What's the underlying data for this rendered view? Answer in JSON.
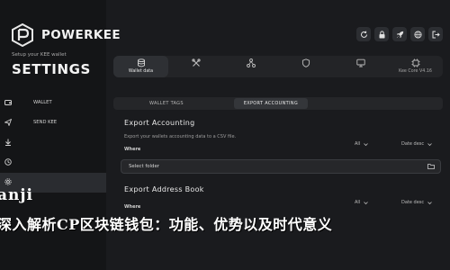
{
  "app": {
    "name": "POWERKEE",
    "setup_label": "Setup your KEE wallet",
    "section_title": "SETTINGS"
  },
  "sidebar": {
    "items": [
      {
        "label": "WALLET",
        "icon": "wallet-icon"
      },
      {
        "label": "SEND KEE",
        "icon": "send-icon"
      },
      {
        "label": "",
        "icon": "receive-icon"
      },
      {
        "label": "",
        "icon": "history-icon"
      },
      {
        "label": "",
        "icon": "settings-icon"
      }
    ]
  },
  "top_icons": [
    "sync-icon",
    "lock-icon",
    "rocket-icon",
    "globe-icon",
    "exit-icon"
  ],
  "tabs": [
    {
      "label": "Wallet data",
      "icon": "database-icon",
      "active": true
    },
    {
      "label": "",
      "icon": "tools-icon",
      "active": false
    },
    {
      "label": "",
      "icon": "network-icon",
      "active": false
    },
    {
      "label": "",
      "icon": "shield-icon",
      "active": false
    },
    {
      "label": "",
      "icon": "display-icon",
      "active": false
    },
    {
      "label": "Kee Core V4.16",
      "icon": "core-icon",
      "active": false
    }
  ],
  "subtabs": [
    {
      "label": "WALLET TAGS",
      "active": false
    },
    {
      "label": "EXPORT ACCOUNTING",
      "active": true
    }
  ],
  "export_accounting": {
    "title": "Export Accounting",
    "description": "Export your wallets accounting data to a CSV file.",
    "where_label": "Where",
    "filter_all": "All",
    "sort": "Date desc",
    "folder_placeholder": "Select folder"
  },
  "export_address_book": {
    "title": "Export Address Book",
    "where_label": "Where",
    "filter_all": "All",
    "sort": "Date desc"
  },
  "overlay": {
    "line1": "anji",
    "line2": "深入解析CP区块链钱包：功能、优势以及时代意义"
  },
  "colors": {
    "background": "#1a1b1e",
    "sidebar": "#141517",
    "panel": "#232427"
  }
}
